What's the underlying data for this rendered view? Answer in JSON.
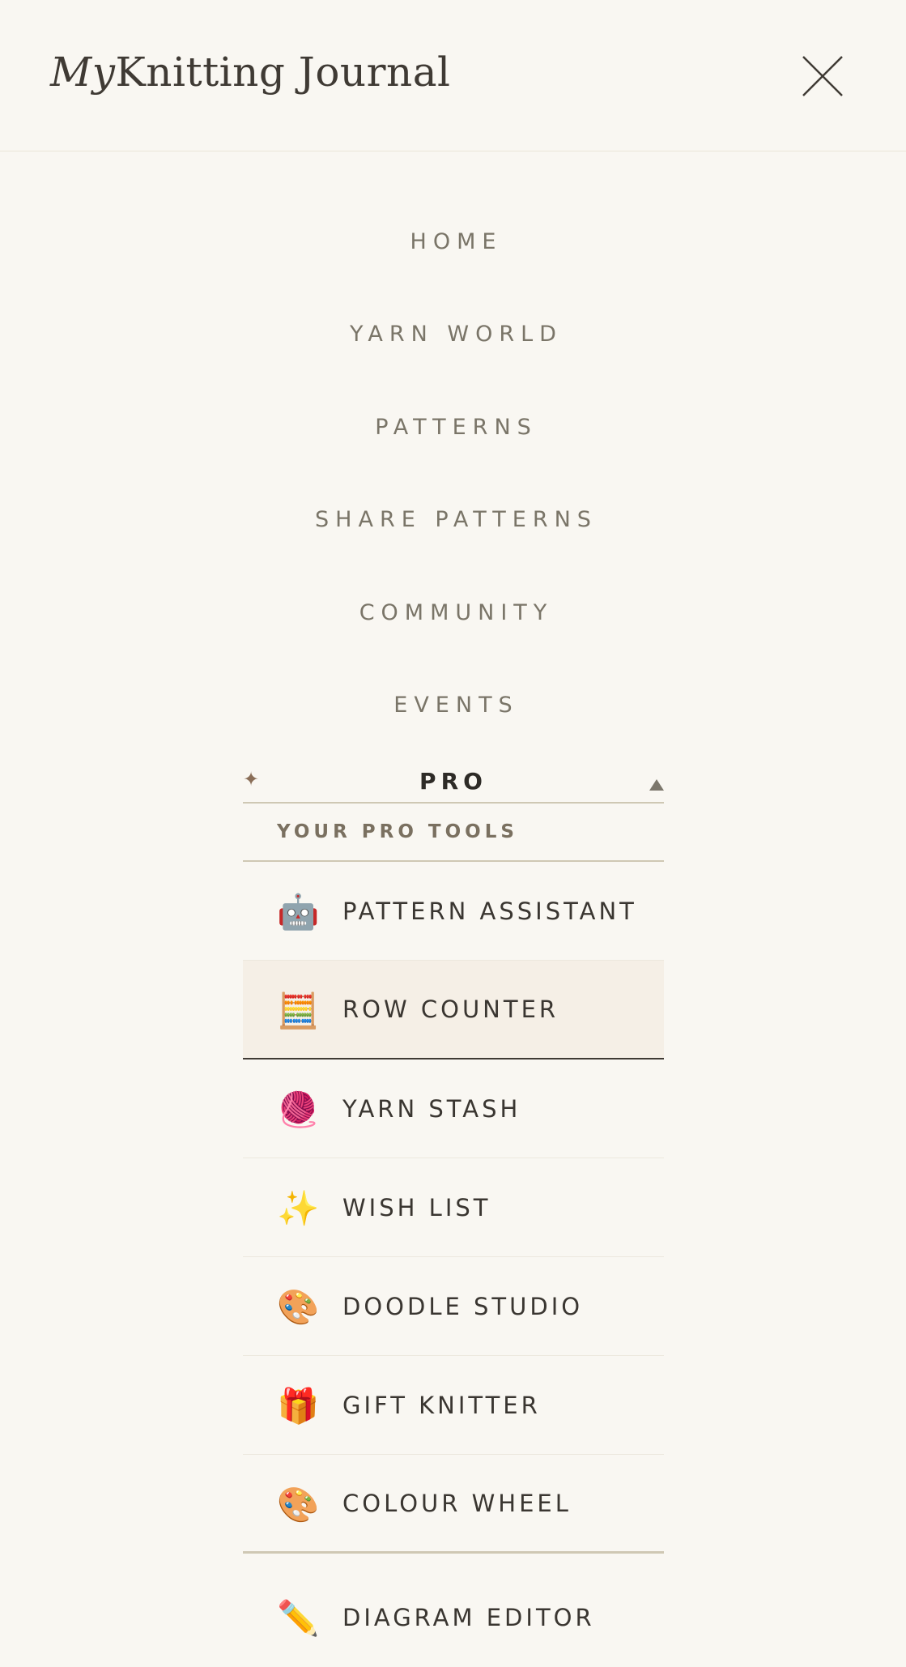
{
  "header": {
    "logo_prefix": "My",
    "logo_suffix": "Knitting Journal"
  },
  "nav": {
    "items": [
      {
        "label": "HOME"
      },
      {
        "label": "YARN WORLD"
      },
      {
        "label": "PATTERNS"
      },
      {
        "label": "SHARE PATTERNS"
      },
      {
        "label": "COMMUNITY"
      },
      {
        "label": "EVENTS"
      }
    ]
  },
  "pro": {
    "title": "PRO",
    "subtitle": "YOUR PRO TOOLS",
    "tools": [
      {
        "icon": "🤖",
        "icon_name": "robot-icon",
        "label": "PATTERN ASSISTANT"
      },
      {
        "icon": "🧮",
        "icon_name": "abacus-icon",
        "label": "ROW COUNTER",
        "active": true
      },
      {
        "icon": "🧶",
        "icon_name": "yarn-ball-icon",
        "label": "YARN STASH"
      },
      {
        "icon": "✨",
        "icon_name": "sparkles-icon",
        "label": "WISH LIST"
      },
      {
        "icon": "🎨",
        "icon_name": "palette-icon",
        "label": "DOODLE STUDIO"
      },
      {
        "icon": "🎁",
        "icon_name": "gift-icon",
        "label": "GIFT KNITTER"
      },
      {
        "icon": "🎨",
        "icon_name": "palette-icon",
        "label": "COLOUR WHEEL"
      },
      {
        "icon": "✏️",
        "icon_name": "pencil-icon",
        "label": "DIAGRAM EDITOR"
      }
    ]
  },
  "colors": {
    "background": "#f9f7f2",
    "active_row": "#f5efe6",
    "divider": "#cfc8b4",
    "nav_text": "#7a7568",
    "dark_text": "#3a3631"
  }
}
